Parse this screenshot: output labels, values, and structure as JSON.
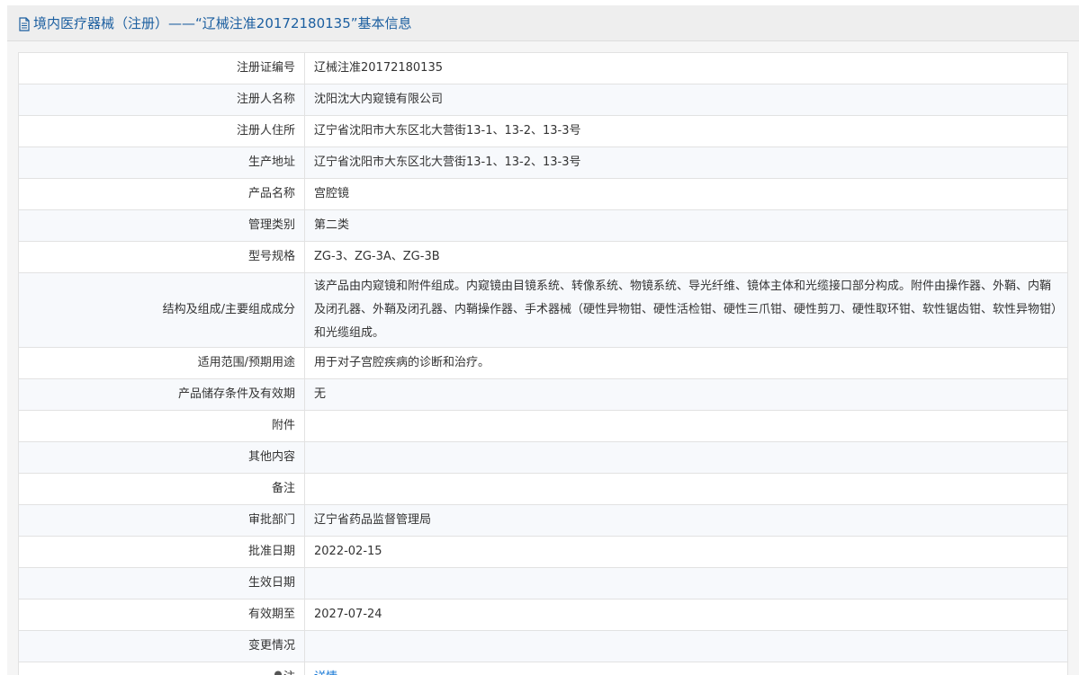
{
  "header": {
    "title": "境内医疗器械（注册）——“辽械注准20172180135”基本信息"
  },
  "rows": [
    {
      "label": "注册证编号",
      "value": "辽械注准20172180135"
    },
    {
      "label": "注册人名称",
      "value": "沈阳沈大内窥镜有限公司"
    },
    {
      "label": "注册人住所",
      "value": "辽宁省沈阳市大东区北大营街13-1、13-2、13-3号"
    },
    {
      "label": "生产地址",
      "value": "辽宁省沈阳市大东区北大营街13-1、13-2、13-3号"
    },
    {
      "label": "产品名称",
      "value": "宫腔镜"
    },
    {
      "label": "管理类别",
      "value": "第二类"
    },
    {
      "label": "型号规格",
      "value": "ZG-3、ZG-3A、ZG-3B"
    },
    {
      "label": "结构及组成/主要组成成分",
      "value": "该产品由内窥镜和附件组成。内窥镜由目镜系统、转像系统、物镜系统、导光纤维、镜体主体和光缆接口部分构成。附件由操作器、外鞘、内鞘及闭孔器、外鞘及闭孔器、内鞘操作器、手术器械（硬性异物钳、硬性活检钳、硬性三爪钳、硬性剪刀、硬性取环钳、软性锯齿钳、软性异物钳）和光缆组成。"
    },
    {
      "label": "适用范围/预期用途",
      "value": "用于对子宫腔疾病的诊断和治疗。"
    },
    {
      "label": "产品储存条件及有效期",
      "value": "无"
    },
    {
      "label": "附件",
      "value": ""
    },
    {
      "label": "其他内容",
      "value": ""
    },
    {
      "label": "备注",
      "value": ""
    },
    {
      "label": "审批部门",
      "value": "辽宁省药品监督管理局"
    },
    {
      "label": "批准日期",
      "value": "2022-02-15"
    },
    {
      "label": "生效日期",
      "value": ""
    },
    {
      "label": "有效期至",
      "value": "2027-07-24"
    },
    {
      "label": "变更情况",
      "value": ""
    }
  ],
  "note_row": {
    "label": "注",
    "link_text": "详情",
    "icon": "lightbulb-icon"
  },
  "colors": {
    "title": "#1c5fa0",
    "link": "#1c7bd6",
    "header_bg": "#eeeeee",
    "stripe_bg": "#f7f9fc",
    "border": "#e2e2e2"
  }
}
